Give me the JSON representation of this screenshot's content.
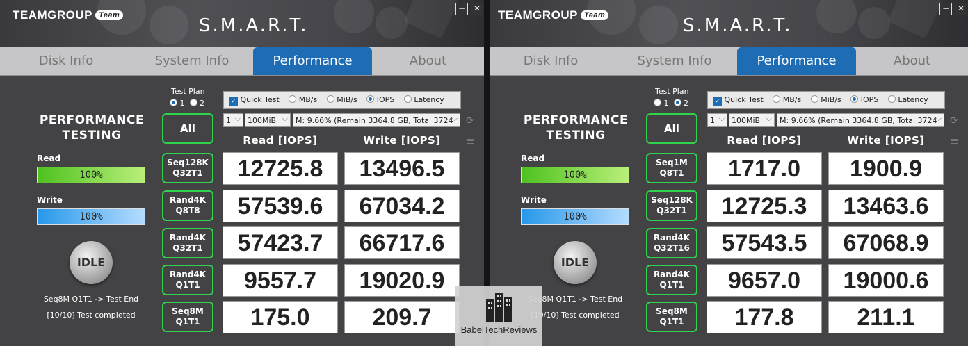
{
  "watermark": "BabelTechReviews",
  "windows": [
    {
      "brand": "TEAMGROUP",
      "brand_badge": "Team",
      "title": "S.M.A.R.T.",
      "controls": {
        "minimize": "−",
        "close": "✕"
      },
      "tabs": [
        {
          "label": "Disk Info",
          "active": false
        },
        {
          "label": "System Info",
          "active": false
        },
        {
          "label": "Performance",
          "active": true
        },
        {
          "label": "About",
          "active": false
        }
      ],
      "section_title_1": "PERFORMANCE",
      "section_title_2": "TESTING",
      "read_label": "Read",
      "read_value": "100%",
      "write_label": "Write",
      "write_value": "100%",
      "state_button": "IDLE",
      "status_line1": "Seq8M Q1T1 -> Test End",
      "status_line2": "[10/10] Test completed",
      "test_plan_label": "Test Plan",
      "test_plan_options": [
        "1",
        "2"
      ],
      "test_plan_selected": "1",
      "quick_test_label": "Quick Test",
      "units": [
        "MB/s",
        "MiB/s",
        "IOPS",
        "Latency"
      ],
      "units_selected": "IOPS",
      "count_select": "1",
      "size_select": "100MiB",
      "drive_select": "M: 9.66% (Remain 3364.8 GB, Total 3724",
      "all_button": "All",
      "read_header": "Read [IOPS]",
      "write_header": "Write [IOPS]",
      "rows": [
        {
          "line1": "Seq128K",
          "line2": "Q32T1",
          "read": "12725.8",
          "write": "13496.5"
        },
        {
          "line1": "Rand4K",
          "line2": "Q8T8",
          "read": "57539.6",
          "write": "67034.2"
        },
        {
          "line1": "Rand4K",
          "line2": "Q32T1",
          "read": "57423.7",
          "write": "66717.6"
        },
        {
          "line1": "Rand4K",
          "line2": "Q1T1",
          "read": "9557.7",
          "write": "19020.9"
        },
        {
          "line1": "Seq8M",
          "line2": "Q1T1",
          "read": "175.0",
          "write": "209.7"
        }
      ]
    },
    {
      "brand": "TEAMGROUP",
      "brand_badge": "Team",
      "title": "S.M.A.R.T.",
      "controls": {
        "minimize": "−",
        "close": "✕"
      },
      "tabs": [
        {
          "label": "Disk Info",
          "active": false
        },
        {
          "label": "System Info",
          "active": false
        },
        {
          "label": "Performance",
          "active": true
        },
        {
          "label": "About",
          "active": false
        }
      ],
      "section_title_1": "PERFORMANCE",
      "section_title_2": "TESTING",
      "read_label": "Read",
      "read_value": "100%",
      "write_label": "Write",
      "write_value": "100%",
      "state_button": "IDLE",
      "status_line1": "Seq8M Q1T1 -> Test End",
      "status_line2": "[10/10] Test completed",
      "test_plan_label": "Test Plan",
      "test_plan_options": [
        "1",
        "2"
      ],
      "test_plan_selected": "2",
      "quick_test_label": "Quick Test",
      "units": [
        "MB/s",
        "MiB/s",
        "IOPS",
        "Latency"
      ],
      "units_selected": "IOPS",
      "count_select": "1",
      "size_select": "100MiB",
      "drive_select": "M: 9.66% (Remain 3364.8 GB, Total 3724",
      "all_button": "All",
      "read_header": "Read [IOPS]",
      "write_header": "Write [IOPS]",
      "rows": [
        {
          "line1": "Seq1M",
          "line2": "Q8T1",
          "read": "1717.0",
          "write": "1900.9"
        },
        {
          "line1": "Seq128K",
          "line2": "Q32T1",
          "read": "12725.3",
          "write": "13463.6"
        },
        {
          "line1": "Rand4K",
          "line2": "Q32T16",
          "read": "57543.5",
          "write": "67068.9"
        },
        {
          "line1": "Rand4K",
          "line2": "Q1T1",
          "read": "9657.0",
          "write": "19000.6"
        },
        {
          "line1": "Seq8M",
          "line2": "Q1T1",
          "read": "177.8",
          "write": "211.1"
        }
      ]
    }
  ]
}
